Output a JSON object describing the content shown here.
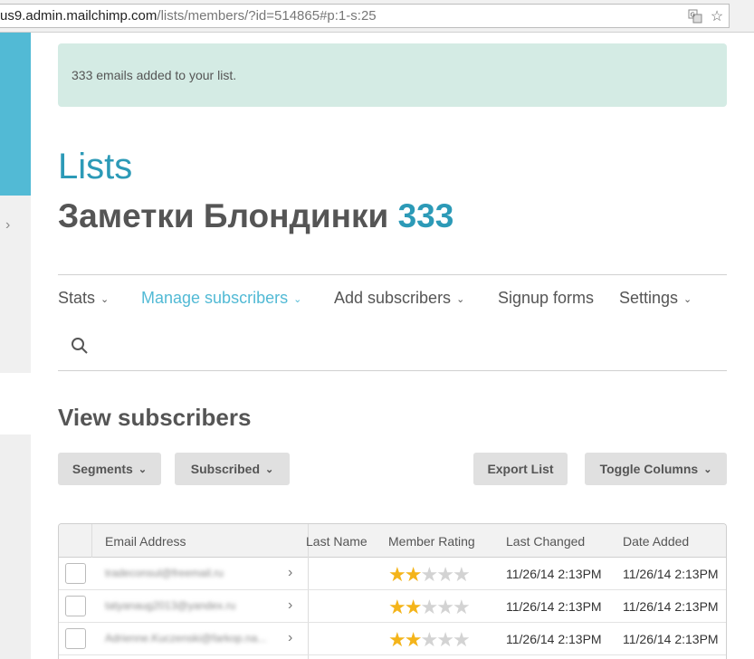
{
  "browser": {
    "url_host": "us9.admin.mailchimp.com",
    "url_path": "/lists/members/?id=514865#p:1-s:25"
  },
  "notice": {
    "text": "333 emails added to your list."
  },
  "header": {
    "title": "Lists",
    "list_name": "Заметки Блондинки",
    "list_count": "333"
  },
  "nav": {
    "items": [
      {
        "label": "Stats",
        "active": false,
        "dropdown": true
      },
      {
        "label": "Manage subscribers",
        "active": true,
        "dropdown": true
      },
      {
        "label": "Add subscribers",
        "active": false,
        "dropdown": true
      },
      {
        "label": "Signup forms",
        "active": false,
        "dropdown": false
      },
      {
        "label": "Settings",
        "active": false,
        "dropdown": true
      }
    ]
  },
  "section": {
    "title": "View subscribers"
  },
  "buttons": {
    "segments": "Segments",
    "subscribed": "Subscribed",
    "export_list": "Export List",
    "toggle_columns": "Toggle Columns"
  },
  "table": {
    "columns": [
      "Email Address",
      "Last Name",
      "Member Rating",
      "Last Changed",
      "Date Added"
    ],
    "rows": [
      {
        "email": "tradeconsul@freemail.ru",
        "rating": 2,
        "last_changed": "11/26/14 2:13PM",
        "date_added": "11/26/14 2:13PM"
      },
      {
        "email": "tatyanaug2013@yandex.ru",
        "rating": 2,
        "last_changed": "11/26/14 2:13PM",
        "date_added": "11/26/14 2:13PM"
      },
      {
        "email": "Adrienne.Kuczenski@farkop.na...",
        "rating": 2,
        "last_changed": "11/26/14 2:13PM",
        "date_added": "11/26/14 2:13PM"
      }
    ],
    "rating_max": 5
  },
  "colors": {
    "accent": "#52bad5",
    "title_blue": "#2c9ab7",
    "notice_bg": "#d4ebe4",
    "star_on": "#f4b41a",
    "star_off": "#d3d3d3"
  },
  "icons": {
    "translate": "translate-icon",
    "bookmark": "star-bookmark-icon",
    "search": "search-icon",
    "chevron": "chevron-down-icon"
  }
}
